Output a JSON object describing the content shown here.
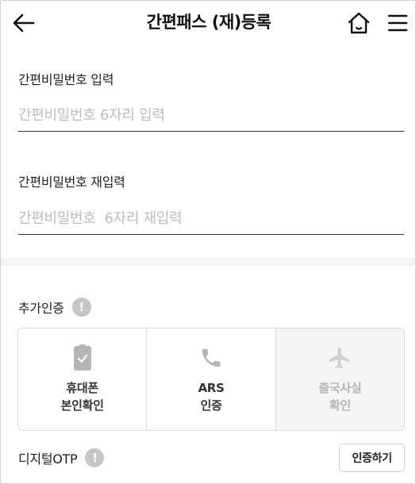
{
  "header": {
    "title": "간편패스 (재)등록",
    "back_icon": "arrow-left-icon",
    "home_icon": "home-icon",
    "menu_icon": "hamburger-menu-icon"
  },
  "fields": {
    "pin": {
      "label": "간편비밀번호 입력",
      "placeholder": "간편비밀번호 6자리 입력",
      "value": ""
    },
    "pin_confirm": {
      "label": "간편비밀번호 재입력",
      "placeholder": "간편비밀번호  6자리 재입력",
      "value": ""
    }
  },
  "extra_auth": {
    "label": "추가인증",
    "info_glyph": "!",
    "options": [
      {
        "line1": "휴대폰",
        "line2": "본인확인",
        "icon": "phone-check-icon",
        "enabled": true
      },
      {
        "line1": "ARS",
        "line2": "인증",
        "icon": "phone-call-icon",
        "enabled": true
      },
      {
        "line1": "출국사실",
        "line2": "확인",
        "icon": "airplane-icon",
        "enabled": false
      }
    ]
  },
  "otp": {
    "label": "디지털OTP",
    "info_glyph": "!",
    "button_label": "인증하기"
  },
  "colors": {
    "text": "#222222",
    "placeholder": "#bdbdbd",
    "icon_gray": "#b5b5b5",
    "disabled_bg": "#f5f5f5",
    "divider": "#f3f3f3"
  }
}
